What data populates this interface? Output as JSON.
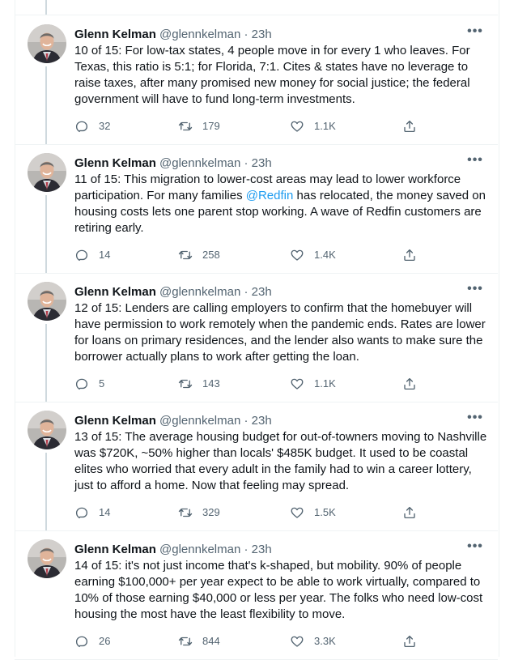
{
  "tweets": [
    {
      "name": "Glenn Kelman",
      "handle": "@glennkelman",
      "time": "23h",
      "text_before": "10 of 15: For low-tax states, 4 people move in for every 1 who leaves. For Texas, this ratio is 5:1; for Florida, 7:1. Cites & states have no leverage to raise taxes, after many promised new money for social justice; the federal government will have to fund long-term investments.",
      "mention": "",
      "text_after": "",
      "replies": "32",
      "retweets": "179",
      "likes": "1.1K"
    },
    {
      "name": "Glenn Kelman",
      "handle": "@glennkelman",
      "time": "23h",
      "text_before": "11 of 15: This migration to lower-cost areas may lead to lower workforce participation. For many families ",
      "mention": "@Redfin",
      "text_after": " has relocated, the money saved on housing costs lets one parent stop working. A wave of Redfin customers are retiring early.",
      "replies": "14",
      "retweets": "258",
      "likes": "1.4K"
    },
    {
      "name": "Glenn Kelman",
      "handle": "@glennkelman",
      "time": "23h",
      "text_before": "12 of 15: Lenders are calling employers to confirm that the homebuyer will have permission to work remotely when the pandemic ends. Rates are lower for loans on primary residences, and the lender also wants to make sure the borrower actually plans to work after getting the loan.",
      "mention": "",
      "text_after": "",
      "replies": "5",
      "retweets": "143",
      "likes": "1.1K"
    },
    {
      "name": "Glenn Kelman",
      "handle": "@glennkelman",
      "time": "23h",
      "text_before": "13 of 15: The average housing budget for out-of-towners moving to Nashville was $720K, ~50% higher than locals' $485K budget. It used to be coastal elites who worried that every adult in the family had to win a career lottery, just to afford a home. Now that feeling may spread.",
      "mention": "",
      "text_after": "",
      "replies": "14",
      "retweets": "329",
      "likes": "1.5K"
    },
    {
      "name": "Glenn Kelman",
      "handle": "@glennkelman",
      "time": "23h",
      "text_before": "14 of 15: it's not just income that's k-shaped, but mobility. 90% of people earning $100,000+ per year expect to be able to work virtually, compared to 10% of those earning $40,000 or less per year. The folks who need low-cost housing the most have the least flexibility to move.",
      "mention": "",
      "text_after": "",
      "replies": "26",
      "retweets": "844",
      "likes": "3.3K"
    }
  ],
  "ui": {
    "separator": "·",
    "more_glyph": "•••",
    "icons": {
      "reply": "reply-icon",
      "retweet": "retweet-icon",
      "like": "like-icon",
      "share": "share-icon",
      "more": "more-icon"
    },
    "colors": {
      "text": "#0f1419",
      "secondary": "#536471",
      "link": "#1d9bf0",
      "thread_line": "#cfd9de",
      "divider": "#eff3f4"
    }
  }
}
